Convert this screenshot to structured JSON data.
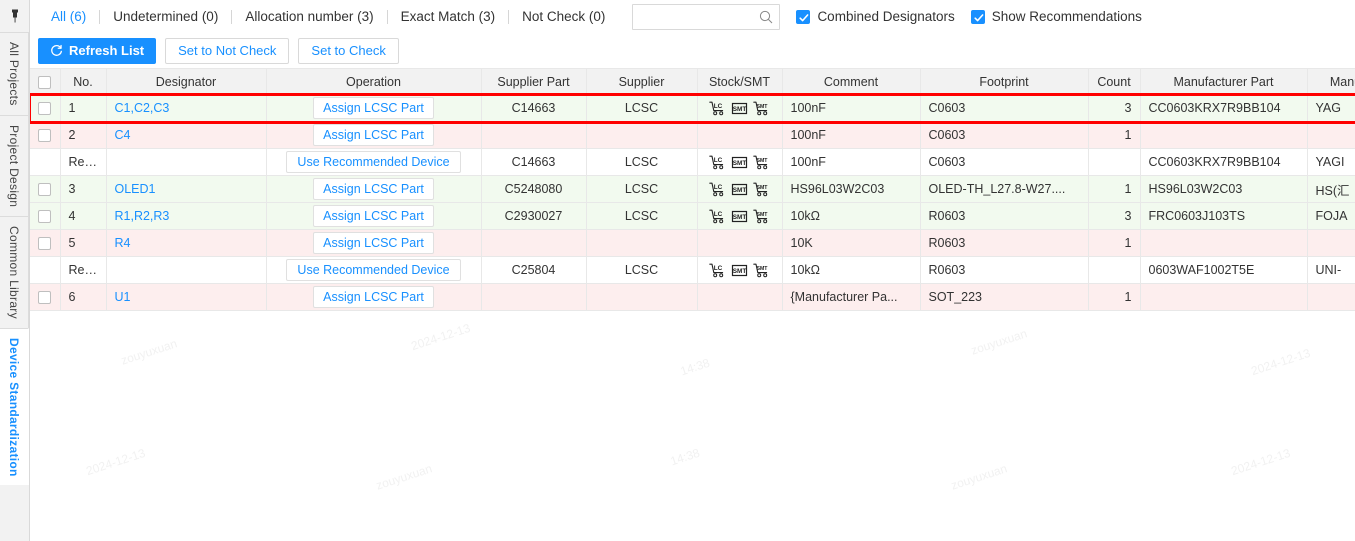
{
  "sidebar": {
    "pin_icon": "pin-icon",
    "tabs": [
      {
        "label": "All Projects",
        "active": false
      },
      {
        "label": "Project Design",
        "active": false
      },
      {
        "label": "Common Library",
        "active": false
      },
      {
        "label": "Device Standardization",
        "active": true
      }
    ]
  },
  "toolbar": {
    "filter_tabs": [
      {
        "label": "All (6)",
        "active": true
      },
      {
        "label": "Undetermined (0)",
        "active": false
      },
      {
        "label": "Allocation number (3)",
        "active": false
      },
      {
        "label": "Exact Match (3)",
        "active": false
      },
      {
        "label": "Not Check (0)",
        "active": false
      }
    ],
    "search": {
      "value": "",
      "placeholder": "",
      "icon": "search-icon"
    },
    "checkboxes": [
      {
        "label": "Combined Designators",
        "checked": true
      },
      {
        "label": "Show Recommendations",
        "checked": true
      }
    ],
    "buttons": [
      {
        "label": "Refresh List",
        "kind": "primary",
        "icon": "refresh-icon"
      },
      {
        "label": "Set to Not Check",
        "kind": "default",
        "icon": ""
      },
      {
        "label": "Set to Check",
        "kind": "default",
        "icon": ""
      }
    ]
  },
  "table": {
    "headers": {
      "check": "",
      "no": "No.",
      "designator": "Designator",
      "operation": "Operation",
      "supplier_part": "Supplier Part",
      "supplier": "Supplier",
      "stock_smt": "Stock/SMT",
      "comment": "Comment",
      "footprint": "Footprint",
      "count": "Count",
      "manufacturer_part": "Manufacturer Part",
      "manufacturer": "Manu"
    },
    "rows": [
      {
        "kind": "item",
        "shade": "green",
        "checkbox": true,
        "highlighted": true,
        "no": "1",
        "designator": "C1,C2,C3",
        "operation": "Assign LCSC Part",
        "supplier_part": "C14663",
        "supplier": "LCSC",
        "stock_icons": [
          "cart-lc-icon",
          "smt-box-icon",
          "cart-smt-icon"
        ],
        "comment": "100nF",
        "footprint": "C0603",
        "count": "3",
        "manufacturer_part": "CC0603KRX7R9BB104",
        "manufacturer": "YAG"
      },
      {
        "kind": "item",
        "shade": "pink",
        "checkbox": true,
        "highlighted": false,
        "no": "2",
        "designator": "C4",
        "operation": "Assign LCSC Part",
        "supplier_part": "",
        "supplier": "",
        "stock_icons": [],
        "comment": "100nF",
        "footprint": "C0603",
        "count": "1",
        "manufacturer_part": "",
        "manufacturer": ""
      },
      {
        "kind": "rec",
        "shade": "rec",
        "checkbox": false,
        "highlighted": false,
        "no": "Rec...",
        "designator": "",
        "operation": "Use Recommended Device",
        "supplier_part": "C14663",
        "supplier": "LCSC",
        "stock_icons": [
          "cart-lc-icon",
          "smt-box-icon",
          "cart-smt-icon"
        ],
        "comment": "100nF",
        "footprint": "C0603",
        "count": "",
        "manufacturer_part": "CC0603KRX7R9BB104",
        "manufacturer": "YAGI"
      },
      {
        "kind": "item",
        "shade": "green",
        "checkbox": true,
        "highlighted": false,
        "no": "3",
        "designator": "OLED1",
        "operation": "Assign LCSC Part",
        "supplier_part": "C5248080",
        "supplier": "LCSC",
        "stock_icons": [
          "cart-lc-icon",
          "smt-box-icon",
          "cart-smt-icon"
        ],
        "comment": "HS96L03W2C03",
        "footprint": "OLED-TH_L27.8-W27....",
        "count": "1",
        "manufacturer_part": "HS96L03W2C03",
        "manufacturer": "HS(汇"
      },
      {
        "kind": "item",
        "shade": "green",
        "checkbox": true,
        "highlighted": false,
        "no": "4",
        "designator": "R1,R2,R3",
        "operation": "Assign LCSC Part",
        "supplier_part": "C2930027",
        "supplier": "LCSC",
        "stock_icons": [
          "cart-lc-icon",
          "smt-box-icon",
          "cart-smt-icon"
        ],
        "comment": "10kΩ",
        "footprint": "R0603",
        "count": "3",
        "manufacturer_part": "FRC0603J103TS",
        "manufacturer": "FOJA"
      },
      {
        "kind": "item",
        "shade": "pink",
        "checkbox": true,
        "highlighted": false,
        "no": "5",
        "designator": "R4",
        "operation": "Assign LCSC Part",
        "supplier_part": "",
        "supplier": "",
        "stock_icons": [],
        "comment": "10K",
        "footprint": "R0603",
        "count": "1",
        "manufacturer_part": "",
        "manufacturer": ""
      },
      {
        "kind": "rec",
        "shade": "rec",
        "checkbox": false,
        "highlighted": false,
        "no": "Rec...",
        "designator": "",
        "operation": "Use Recommended Device",
        "supplier_part": "C25804",
        "supplier": "LCSC",
        "stock_icons": [
          "cart-lc-icon",
          "smt-box-icon",
          "cart-smt-icon"
        ],
        "comment": "10kΩ",
        "footprint": "R0603",
        "count": "",
        "manufacturer_part": "0603WAF1002T5E",
        "manufacturer": "UNI-"
      },
      {
        "kind": "item",
        "shade": "pink",
        "checkbox": true,
        "highlighted": false,
        "no": "6",
        "designator": "U1",
        "operation": "Assign LCSC Part",
        "supplier_part": "",
        "supplier": "",
        "stock_icons": [],
        "comment": "{Manufacturer Pa...",
        "footprint": "SOT_223",
        "count": "1",
        "manufacturer_part": "",
        "manufacturer": ""
      }
    ]
  },
  "colors": {
    "accent": "#1890ff",
    "row_green": "#f2faef",
    "row_pink": "#fdeeee",
    "highlight_border": "#ff0000",
    "header_bg": "#f2f2f2"
  },
  "watermark": {
    "name": "zouyuxuan",
    "date": "2024-12-13",
    "time": "14:38"
  }
}
